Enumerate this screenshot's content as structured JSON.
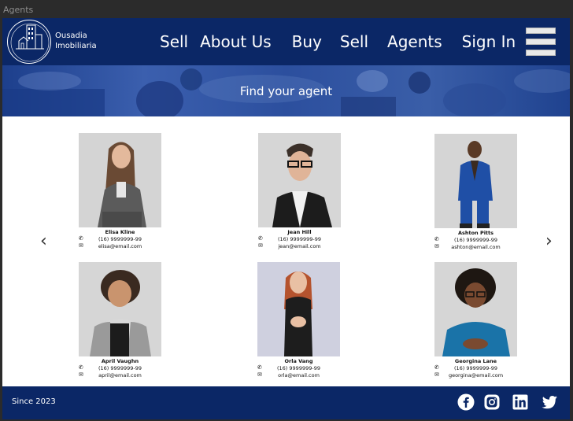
{
  "window": {
    "title": "Agents"
  },
  "brand": {
    "name_line1": "Ousadia",
    "name_line2": "Imobiliaria"
  },
  "nav": {
    "items": [
      "Sell",
      "About Us",
      "Buy",
      "Sell",
      "Agents",
      "Sign In"
    ]
  },
  "hero": {
    "title": "Find your agent"
  },
  "carousel": {
    "prev": "‹",
    "next": "›"
  },
  "agents": [
    {
      "name": "Elisa Kline",
      "phone": "(16) 9999999-99",
      "email": "elisa@email.com"
    },
    {
      "name": "Jean Hill",
      "phone": "(16) 9999999-99",
      "email": "jean@email.com"
    },
    {
      "name": "Ashton Pitts",
      "phone": "(16) 9999999-99",
      "email": "ashton@email.com"
    },
    {
      "name": "April Vaughn",
      "phone": "(16) 9999999-99",
      "email": "april@email.com"
    },
    {
      "name": "Orla Vang",
      "phone": "(16) 9999999-99",
      "email": "orla@email.com"
    },
    {
      "name": "Georgina Lane",
      "phone": "(16) 9999999-99",
      "email": "georgina@email.com"
    }
  ],
  "footer": {
    "since": "Since 2023",
    "social": [
      "facebook-icon",
      "instagram-icon",
      "linkedin-icon",
      "twitter-icon"
    ]
  },
  "colors": {
    "navy": "#0b2766",
    "hero_blue": "#2c4f9e",
    "white": "#ffffff"
  }
}
